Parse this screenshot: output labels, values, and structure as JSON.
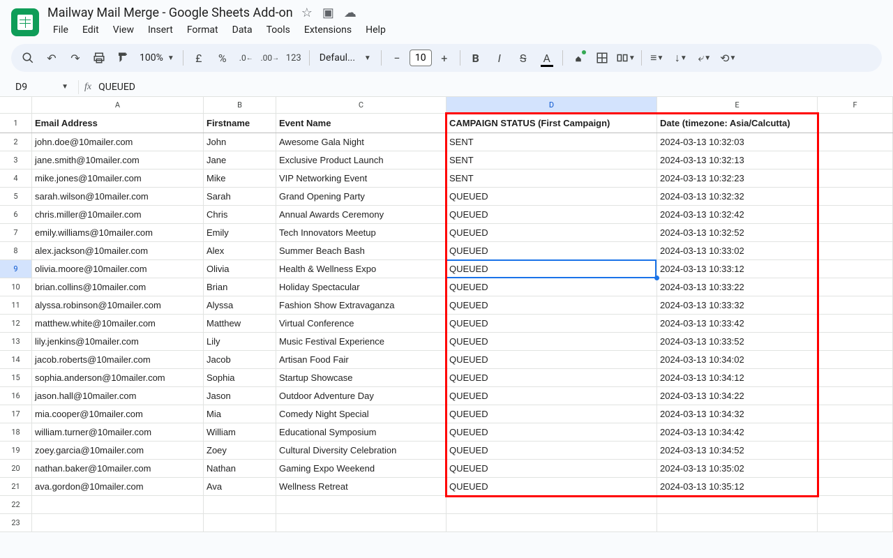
{
  "doc": {
    "title": "Mailway Mail Merge - Google Sheets Add-on"
  },
  "menus": [
    "File",
    "Edit",
    "View",
    "Insert",
    "Format",
    "Data",
    "Tools",
    "Extensions",
    "Help"
  ],
  "toolbar": {
    "zoom": "100%",
    "currency": "£",
    "percent": "%",
    "dec_dec": ".0",
    "inc_dec": ".00",
    "numfmt": "123",
    "font": "Defaul...",
    "fontsize_minus": "−",
    "fontsize": "10",
    "fontsize_plus": "+"
  },
  "namebox": "D9",
  "formula": "QUEUED",
  "cols": [
    "A",
    "B",
    "C",
    "D",
    "E",
    "F"
  ],
  "headers": {
    "a": "Email Address",
    "b": "Firstname",
    "c": "Event Name",
    "d": "CAMPAIGN STATUS (First Campaign)",
    "e": "Date (timezone: Asia/Calcutta)"
  },
  "rows": [
    {
      "n": "2",
      "a": "john.doe@10mailer.com",
      "b": "John",
      "c": "Awesome Gala Night",
      "d": "SENT",
      "e": "2024-03-13 10:32:03"
    },
    {
      "n": "3",
      "a": "jane.smith@10mailer.com",
      "b": "Jane",
      "c": "Exclusive Product Launch",
      "d": "SENT",
      "e": "2024-03-13 10:32:13"
    },
    {
      "n": "4",
      "a": "mike.jones@10mailer.com",
      "b": "Mike",
      "c": "VIP Networking Event",
      "d": "SENT",
      "e": "2024-03-13 10:32:23"
    },
    {
      "n": "5",
      "a": "sarah.wilson@10mailer.com",
      "b": "Sarah",
      "c": "Grand Opening Party",
      "d": "QUEUED",
      "e": "2024-03-13 10:32:32"
    },
    {
      "n": "6",
      "a": "chris.miller@10mailer.com",
      "b": "Chris",
      "c": "Annual Awards Ceremony",
      "d": "QUEUED",
      "e": "2024-03-13 10:32:42"
    },
    {
      "n": "7",
      "a": "emily.williams@10mailer.com",
      "b": "Emily",
      "c": "Tech Innovators Meetup",
      "d": "QUEUED",
      "e": "2024-03-13 10:32:52"
    },
    {
      "n": "8",
      "a": "alex.jackson@10mailer.com",
      "b": "Alex",
      "c": "Summer Beach Bash",
      "d": "QUEUED",
      "e": "2024-03-13 10:33:02"
    },
    {
      "n": "9",
      "a": "olivia.moore@10mailer.com",
      "b": "Olivia",
      "c": "Health & Wellness Expo",
      "d": "QUEUED",
      "e": "2024-03-13 10:33:12"
    },
    {
      "n": "10",
      "a": "brian.collins@10mailer.com",
      "b": "Brian",
      "c": "Holiday Spectacular",
      "d": "QUEUED",
      "e": "2024-03-13 10:33:22"
    },
    {
      "n": "11",
      "a": "alyssa.robinson@10mailer.com",
      "b": "Alyssa",
      "c": "Fashion Show Extravaganza",
      "d": "QUEUED",
      "e": "2024-03-13 10:33:32"
    },
    {
      "n": "12",
      "a": "matthew.white@10mailer.com",
      "b": "Matthew",
      "c": "Virtual Conference",
      "d": "QUEUED",
      "e": "2024-03-13 10:33:42"
    },
    {
      "n": "13",
      "a": "lily.jenkins@10mailer.com",
      "b": "Lily",
      "c": "Music Festival Experience",
      "d": "QUEUED",
      "e": "2024-03-13 10:33:52"
    },
    {
      "n": "14",
      "a": "jacob.roberts@10mailer.com",
      "b": "Jacob",
      "c": "Artisan Food Fair",
      "d": "QUEUED",
      "e": "2024-03-13 10:34:02"
    },
    {
      "n": "15",
      "a": "sophia.anderson@10mailer.com",
      "b": "Sophia",
      "c": "Startup Showcase",
      "d": "QUEUED",
      "e": "2024-03-13 10:34:12"
    },
    {
      "n": "16",
      "a": "jason.hall@10mailer.com",
      "b": "Jason",
      "c": "Outdoor Adventure Day",
      "d": "QUEUED",
      "e": "2024-03-13 10:34:22"
    },
    {
      "n": "17",
      "a": "mia.cooper@10mailer.com",
      "b": "Mia",
      "c": "Comedy Night Special",
      "d": "QUEUED",
      "e": "2024-03-13 10:34:32"
    },
    {
      "n": "18",
      "a": "william.turner@10mailer.com",
      "b": "William",
      "c": "Educational Symposium",
      "d": "QUEUED",
      "e": "2024-03-13 10:34:42"
    },
    {
      "n": "19",
      "a": "zoey.garcia@10mailer.com",
      "b": "Zoey",
      "c": "Cultural Diversity Celebration",
      "d": "QUEUED",
      "e": "2024-03-13 10:34:52"
    },
    {
      "n": "20",
      "a": "nathan.baker@10mailer.com",
      "b": "Nathan",
      "c": "Gaming Expo Weekend",
      "d": "QUEUED",
      "e": "2024-03-13 10:35:02"
    },
    {
      "n": "21",
      "a": "ava.gordon@10mailer.com",
      "b": "Ava",
      "c": "Wellness Retreat",
      "d": "QUEUED",
      "e": "2024-03-13 10:35:12"
    }
  ],
  "emptyRows": [
    "22",
    "23"
  ]
}
